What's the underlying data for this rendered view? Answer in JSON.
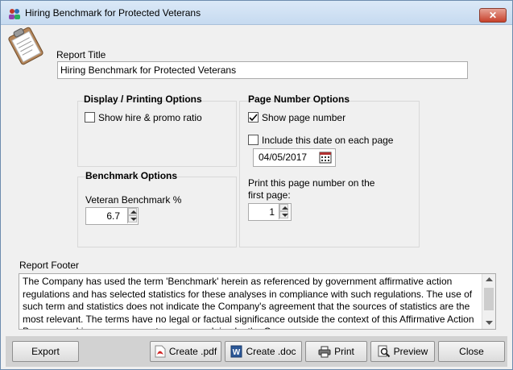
{
  "window": {
    "title": "Hiring Benchmark for Protected Veterans",
    "close_glyph": "✕"
  },
  "report_title": {
    "label": "Report Title",
    "value": "Hiring Benchmark for Protected Veterans"
  },
  "display_options": {
    "title": "Display / Printing Options",
    "show_hire_promo": {
      "label": "Show hire & promo ratio",
      "checked": false
    }
  },
  "benchmark_options": {
    "title": "Benchmark Options",
    "veteran_label": "Veteran Benchmark %",
    "veteran_value": "6.7"
  },
  "page_number_options": {
    "title": "Page Number Options",
    "show_page_number": {
      "label": "Show page number",
      "checked": true
    },
    "include_date": {
      "label": "Include this date on each page",
      "checked": false
    },
    "date_value": "04/05/2017",
    "first_page_label_1": "Print this page number on the",
    "first_page_label_2": "first page:",
    "first_page_value": "1"
  },
  "report_footer": {
    "label": "Report Footer",
    "text": "The Company has used the term 'Benchmark' herein as referenced by government affirmative action regulations and has selected statistics for these analyses in compliance with such regulations. The use of such term and statistics does not indicate the Company's agreement that the sources of statistics are the most relevant. The terms have no legal or factual significance outside the context of this Affirmative Action Program and in no way suggest any wrong doing by the Company."
  },
  "buttons": {
    "export": "Export",
    "create_pdf": "Create .pdf",
    "create_doc": "Create .doc",
    "print": "Print",
    "preview": "Preview",
    "close": "Close"
  },
  "icons": {
    "app": "people-icon",
    "clipboard": "clipboard-icon",
    "calendar": "calendar-icon",
    "pdf": "pdf-icon",
    "word": "word-doc-icon",
    "printer": "printer-icon",
    "preview": "magnifier-icon"
  },
  "colors": {
    "title_bar": "#c6daf0",
    "close_button": "#c7412b",
    "button_bar": "#d2d2d2"
  }
}
